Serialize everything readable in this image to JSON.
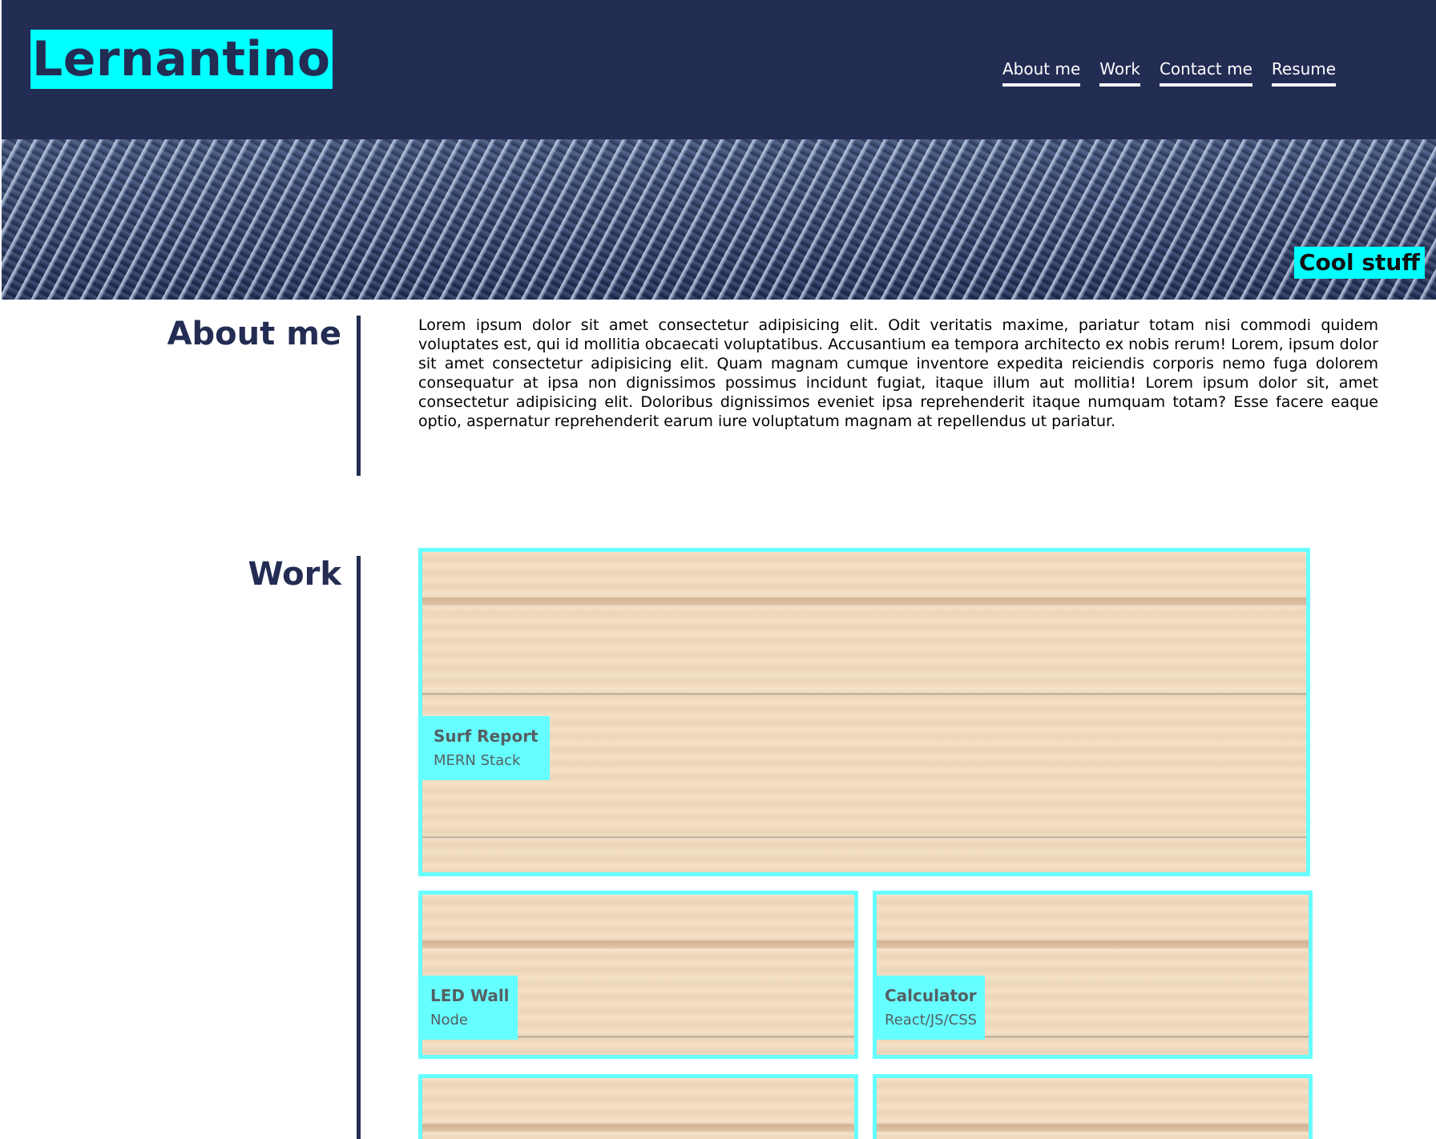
{
  "header": {
    "brand": "Lernantino",
    "nav": [
      {
        "label": "About me"
      },
      {
        "label": "Work"
      },
      {
        "label": "Contact me"
      },
      {
        "label": "Resume"
      }
    ]
  },
  "banner": {
    "tag": "Cool stuff"
  },
  "about": {
    "title": "About me",
    "body": "Lorem ipsum dolor sit amet consectetur adipisicing elit. Odit veritatis maxime, pariatur totam nisi commodi quidem voluptates est, qui id mollitia obcaecati voluptatibus. Accusantium ea tempora architecto ex nobis rerum! Lorem, ipsum dolor sit amet consectetur adipisicing elit. Quam magnam cumque inventore expedita reiciendis corporis nemo fuga dolorem consequatur at ipsa non dignissimos possimus incidunt fugiat, itaque illum aut mollitia! Lorem ipsum dolor sit, amet consectetur adipisicing elit. Doloribus dignissimos eveniet ipsa reprehenderit itaque numquam totam? Esse facere eaque optio, aspernatur reprehenderit earum iure voluptatum magnam at repellendus ut pariatur."
  },
  "work": {
    "title": "Work",
    "projects": [
      {
        "title": "Surf Report",
        "stack": "MERN Stack"
      },
      {
        "title": "LED Wall",
        "stack": "Node"
      },
      {
        "title": "Calculator",
        "stack": "React/JS/CSS"
      }
    ]
  },
  "colors": {
    "header_bg": "#232c53",
    "accent": "#00ffff",
    "card_border": "#66ffff"
  }
}
